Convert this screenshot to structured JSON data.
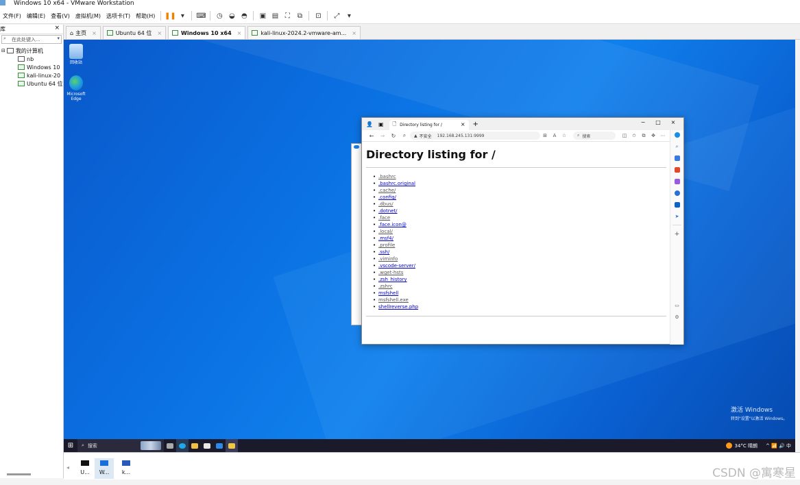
{
  "window": {
    "title": "Windows 10 x64 - VMware Workstation"
  },
  "menubar": {
    "items": [
      "文件(F)",
      "编辑(E)",
      "查看(V)",
      "虚拟机(M)",
      "选项卡(T)",
      "帮助(H)"
    ],
    "pause_icon": "pause-icon",
    "toolbar_icons": [
      "send-keys-icon",
      "snapshot-icon",
      "revert-snapshot-icon",
      "snapshot-manager-icon",
      "console-view-icon",
      "thumbnail-view-icon",
      "full-screen-icon",
      "unity-icon",
      "terminal-icon",
      "stretch-icon"
    ]
  },
  "library": {
    "title": "库",
    "close": "×",
    "search_placeholder": "在此处键入...",
    "tree": [
      {
        "label": "我的计算机",
        "level": 0
      },
      {
        "label": "nb",
        "level": 1
      },
      {
        "label": "Windows 10",
        "level": 1
      },
      {
        "label": "kali-linux-20",
        "level": 1
      },
      {
        "label": "Ubuntu 64 位",
        "level": 1
      }
    ]
  },
  "tabs": [
    {
      "label": "主页",
      "active": false
    },
    {
      "label": "Ubuntu 64 位",
      "active": false
    },
    {
      "label": "Windows 10 x64",
      "active": true
    },
    {
      "label": "kali-linux-2024.2-vmware-am...",
      "active": false
    }
  ],
  "desktop_icons": [
    {
      "label": "回收站"
    },
    {
      "label": "Microsoft Edge"
    }
  ],
  "browser": {
    "tab_title": "Directory listing for /",
    "tab_close": "×",
    "new_tab": "+",
    "window_controls": [
      "−",
      "□",
      "×"
    ],
    "not_secure": "不安全",
    "url": "192.168.245.131:9999",
    "search_placeholder": "搜索",
    "page_heading": "Directory listing for /",
    "listing": [
      {
        "name": ".bashrc",
        "link": false
      },
      {
        "name": ".bashrc.original",
        "link": true
      },
      {
        "name": ".cache/",
        "link": false
      },
      {
        "name": ".config/",
        "link": true
      },
      {
        "name": ".dbus/",
        "link": false
      },
      {
        "name": ".dotnet/",
        "link": true
      },
      {
        "name": ".face",
        "link": false
      },
      {
        "name": ".face.icon@",
        "link": true
      },
      {
        "name": ".local/",
        "link": false
      },
      {
        "name": ".msf4/",
        "link": true
      },
      {
        "name": ".profile",
        "link": false
      },
      {
        "name": ".ssh/",
        "link": true
      },
      {
        "name": ".viminfo",
        "link": false
      },
      {
        "name": ".vscode-server/",
        "link": true
      },
      {
        "name": ".wget-hsts",
        "link": false
      },
      {
        "name": ".zsh_history",
        "link": true
      },
      {
        "name": ".zshrc",
        "link": false
      },
      {
        "name": "msfshell",
        "link": true
      },
      {
        "name": "msfshell.exe",
        "link": false
      },
      {
        "name": "shellreverse.php",
        "link": true
      }
    ]
  },
  "activation": {
    "line1": "激活 Windows",
    "line2": "转到\"设置\"以激活 Windows。"
  },
  "taskbar": {
    "search_placeholder": "搜索",
    "weather": "34°C 晴朗",
    "tray": "^ 📶 🔊 中"
  },
  "thumbnails": [
    {
      "label": "U...",
      "active": false
    },
    {
      "label": "W...",
      "active": true
    },
    {
      "label": "k...",
      "active": false
    }
  ],
  "watermark": "CSDN @寓寒星"
}
